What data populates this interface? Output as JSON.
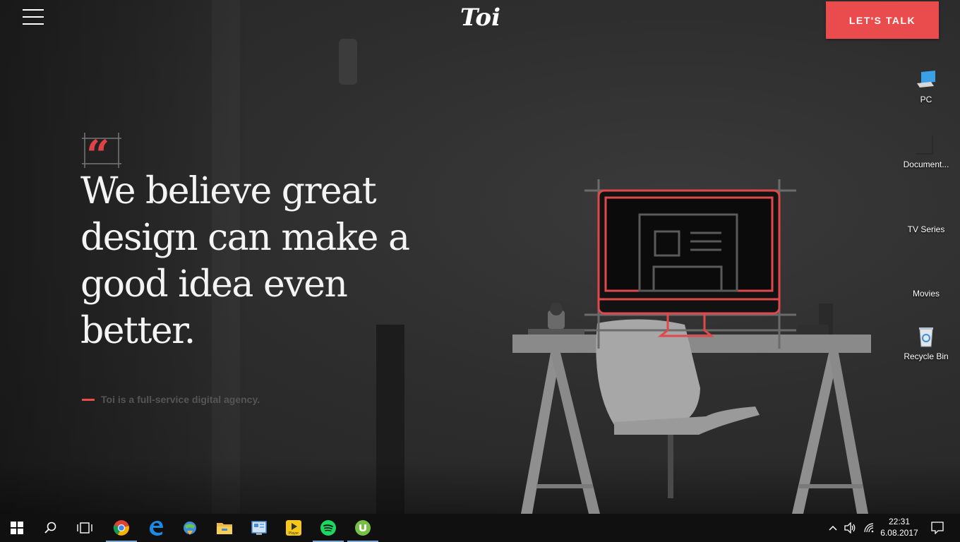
{
  "site": {
    "logo_text": "Toi",
    "cta_label": "LET'S TALK",
    "headline": "We believe great design can make a good idea even better.",
    "tagline": "Toi is a full-service digital agency.",
    "accent_color": "#ea4c4e"
  },
  "desktop": {
    "icons": [
      {
        "label": "PC",
        "icon": "computer-icon"
      },
      {
        "label": "Document...",
        "icon": "document-icon"
      },
      {
        "label": "TV Series",
        "icon": "folder-icon"
      },
      {
        "label": "Movies",
        "icon": "folder-icon"
      },
      {
        "label": "Recycle Bin",
        "icon": "recycle-bin-icon"
      }
    ]
  },
  "taskbar": {
    "apps": [
      {
        "name": "Start",
        "icon": "windows-start-icon"
      },
      {
        "name": "Search",
        "icon": "search-icon"
      },
      {
        "name": "Task View",
        "icon": "task-view-icon"
      },
      {
        "name": "Chrome",
        "icon": "chrome-icon"
      },
      {
        "name": "Edge",
        "icon": "edge-icon"
      },
      {
        "name": "Download Manager",
        "icon": "globe-download-icon"
      },
      {
        "name": "File Explorer",
        "icon": "folder-icon"
      },
      {
        "name": "Control Panel",
        "icon": "control-panel-icon"
      },
      {
        "name": "Player",
        "icon": "player-icon"
      },
      {
        "name": "Spotify",
        "icon": "spotify-icon"
      },
      {
        "name": "uTorrent",
        "icon": "utorrent-icon"
      }
    ],
    "player_badge": "Player",
    "clock": {
      "time": "22:31",
      "date": "6.08.2017"
    }
  }
}
